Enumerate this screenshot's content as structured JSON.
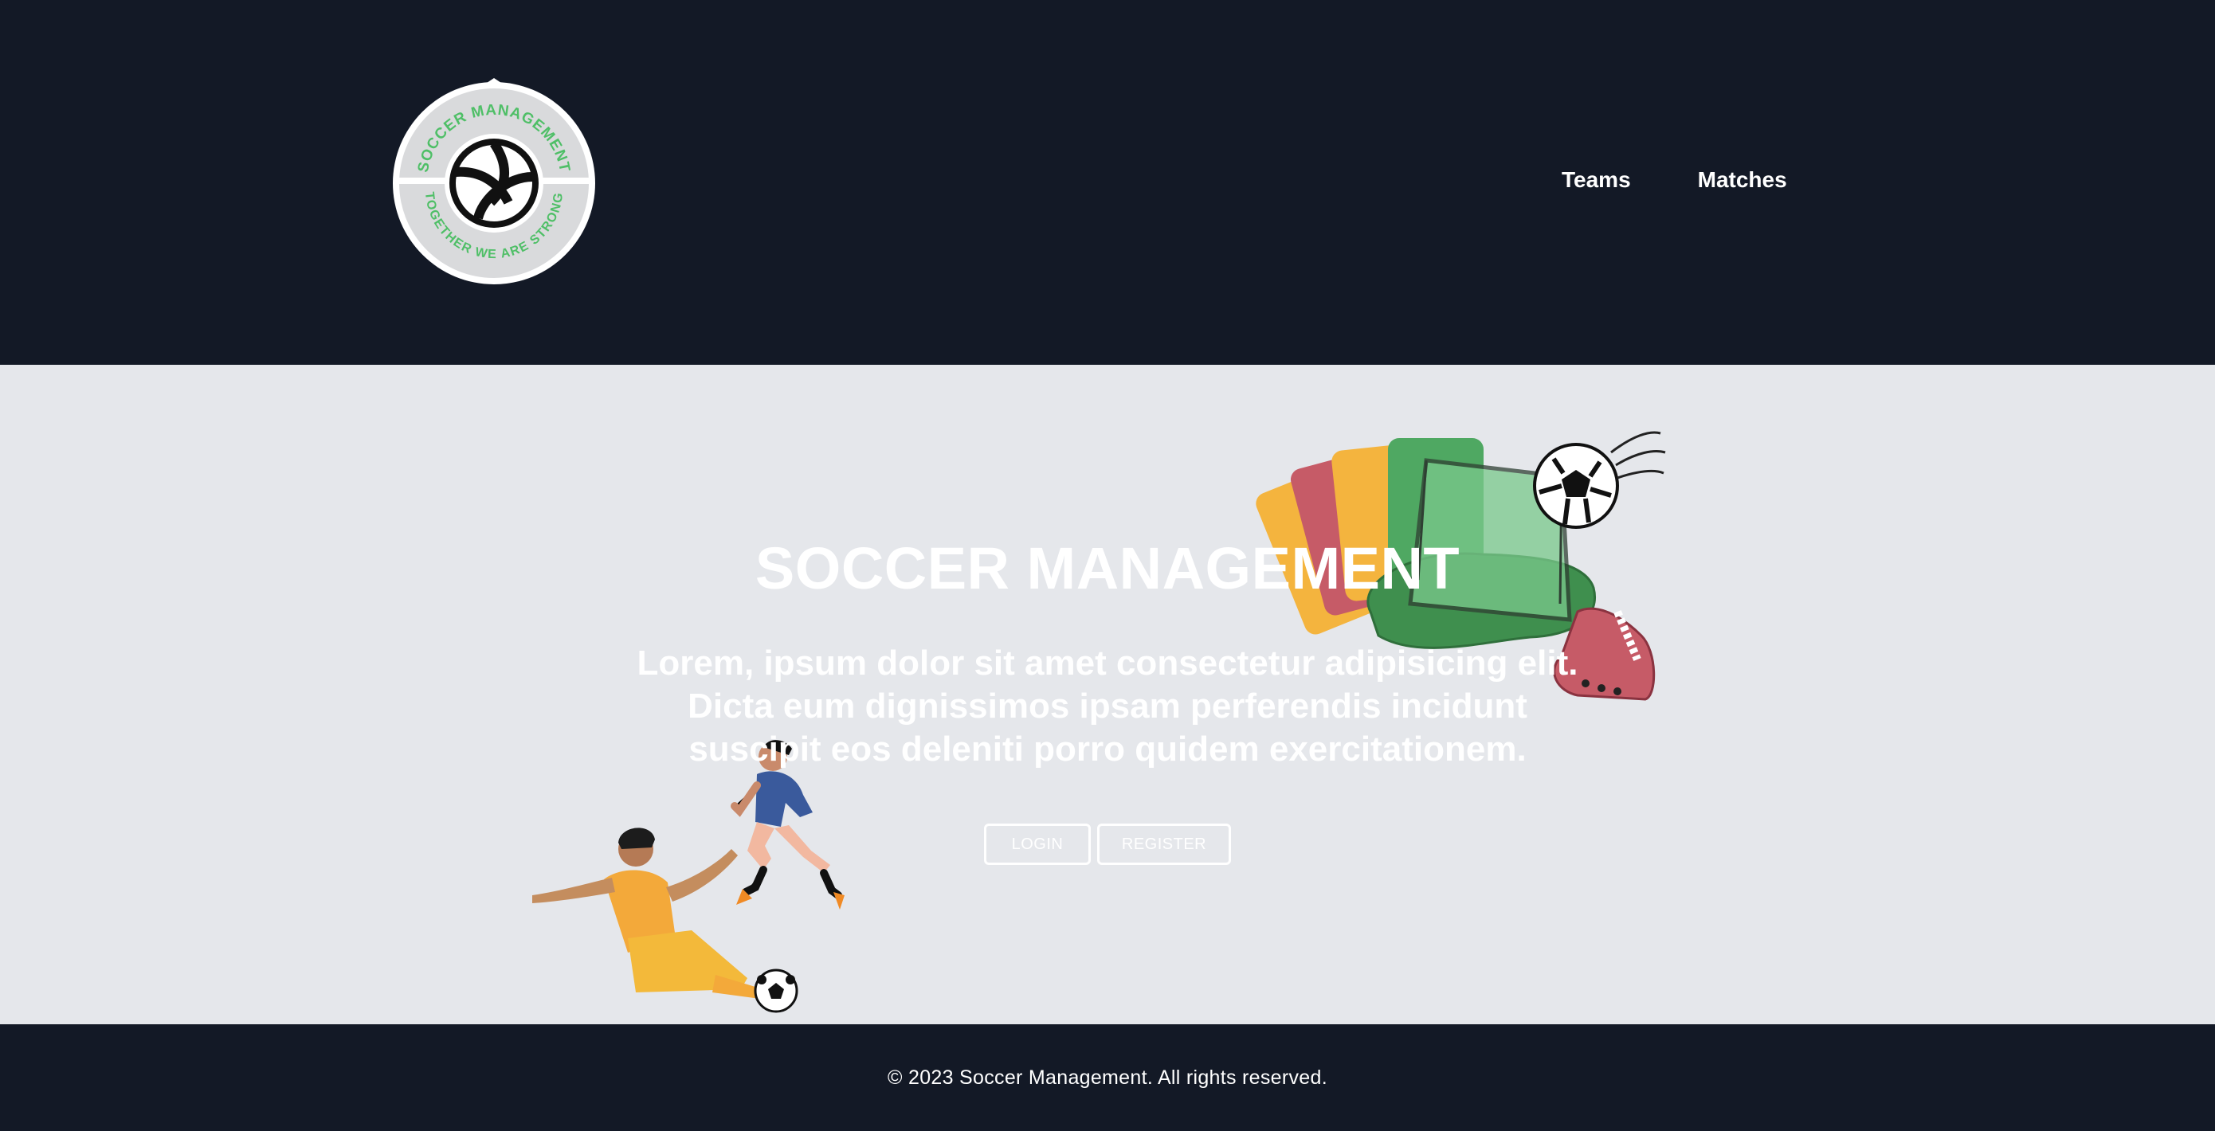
{
  "header": {
    "logo": {
      "top_text": "SOCCER MANAGEMENT",
      "bottom_text": "TOGETHER WE ARE STRONG",
      "icon": "soccer-ball-icon"
    },
    "nav": [
      {
        "label": "Teams"
      },
      {
        "label": "Matches"
      }
    ]
  },
  "hero": {
    "title": "SOCCER MANAGEMENT",
    "description": "Lorem, ipsum dolor sit amet consectetur adipisicing elit. Dicta eum dignissimos ipsam perferendis incidunt suscipit eos deleniti porro quidem exercitationem.",
    "buttons": {
      "login": "Login",
      "register": "Register"
    },
    "illustrations": [
      "referee-cards-goal-illustration",
      "players-tackle-illustration"
    ]
  },
  "footer": {
    "copyright": "© 2023 Soccer Management. All rights reserved."
  },
  "colors": {
    "header_bg": "#131926",
    "hero_bg": "#e5e7eb",
    "text": "#ffffff",
    "logo_green": "#4fbf67"
  }
}
